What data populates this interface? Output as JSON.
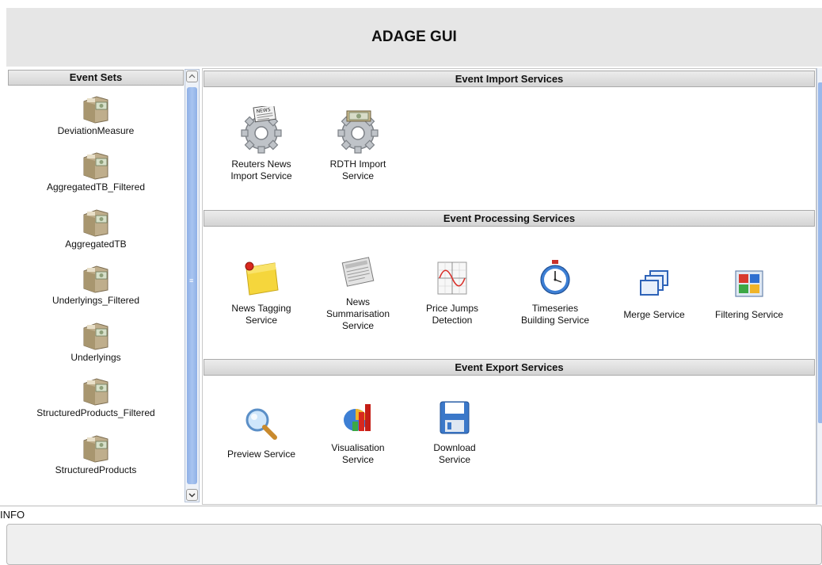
{
  "app": {
    "title": "ADAGE GUI"
  },
  "event_sets": {
    "header": "Event Sets",
    "items": [
      {
        "label": "DeviationMeasure"
      },
      {
        "label": "AggregatedTB_Filtered"
      },
      {
        "label": "AggregatedTB"
      },
      {
        "label": "Underlyings_Filtered"
      },
      {
        "label": "Underlyings"
      },
      {
        "label": "StructuredProducts_Filtered"
      },
      {
        "label": "StructuredProducts"
      }
    ]
  },
  "import_services": {
    "header": "Event Import Services",
    "items": [
      {
        "line1": "Reuters News",
        "line2": "Import Service",
        "icon": "news-gear-icon"
      },
      {
        "line1": "RDTH Import",
        "line2": "Service",
        "icon": "money-gear-icon"
      }
    ]
  },
  "processing_services": {
    "header": "Event Processing Services",
    "items": [
      {
        "line1": "News Tagging",
        "line2": "Service",
        "line3": "",
        "icon": "sticky-note-icon"
      },
      {
        "line1": "News",
        "line2": "Summarisation",
        "line3": "Service",
        "icon": "newspaper-icon"
      },
      {
        "line1": "Price Jumps",
        "line2": "Detection",
        "line3": "",
        "icon": "sine-chart-icon"
      },
      {
        "line1": "Timeseries",
        "line2": "Building Service",
        "line3": "",
        "icon": "stopwatch-icon"
      },
      {
        "line1": "Merge Service",
        "line2": "",
        "line3": "",
        "icon": "stacked-windows-icon"
      },
      {
        "line1": "Filtering Service",
        "line2": "",
        "line3": "",
        "icon": "color-grid-icon"
      }
    ]
  },
  "export_services": {
    "header": "Event Export Services",
    "items": [
      {
        "line1": "Preview Service",
        "line2": "",
        "icon": "magnifier-icon"
      },
      {
        "line1": "Visualisation",
        "line2": "Service",
        "icon": "bar-chart-icon"
      },
      {
        "line1": "Download",
        "line2": "Service",
        "icon": "floppy-disk-icon"
      }
    ]
  },
  "info": {
    "label": "INFO",
    "text": ""
  }
}
